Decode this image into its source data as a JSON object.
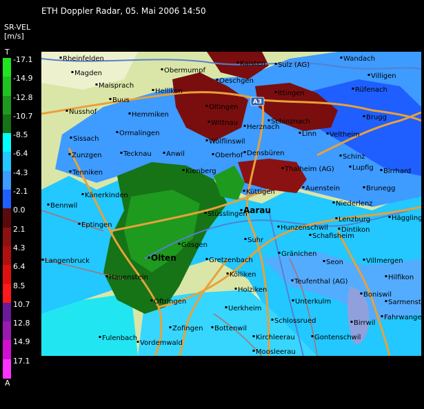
{
  "title": "ETH Doppler Radar, 05. Mai 2006 14:50",
  "legend": {
    "variable": "SR-VEL",
    "unit": "[m/s]",
    "top_marker": "T",
    "bottom_marker": "A",
    "entries": [
      {
        "label": "-17.1",
        "color": "#1fe61f"
      },
      {
        "label": "-14.9",
        "color": "#20c420"
      },
      {
        "label": "-12.8",
        "color": "#1e9a1e"
      },
      {
        "label": "-10.7",
        "color": "#167316"
      },
      {
        "label": "-8.5",
        "color": "#00ffff"
      },
      {
        "label": "-6.4",
        "color": "#22c8ff"
      },
      {
        "label": "-4.3",
        "color": "#3e9bff"
      },
      {
        "label": "-2.1",
        "color": "#1f5fff"
      },
      {
        "label": "0.0",
        "color": "#5a0a0a"
      },
      {
        "label": "2.1",
        "color": "#8b1212"
      },
      {
        "label": "4.3",
        "color": "#b01010"
      },
      {
        "label": "6.4",
        "color": "#e01010"
      },
      {
        "label": "8.5",
        "color": "#ff1a1a"
      },
      {
        "label": "10.7",
        "color": "#6a1a9a"
      },
      {
        "label": "12.8",
        "color": "#9a1ab0"
      },
      {
        "label": "14.9",
        "color": "#d010d0"
      },
      {
        "label": "17.1",
        "color": "#ff33ff"
      }
    ]
  },
  "map": {
    "places": [
      {
        "name": "Rheinfelden"
      },
      {
        "name": "Magden"
      },
      {
        "name": "Obermumpf"
      },
      {
        "name": "Kaisten"
      },
      {
        "name": "Sulz (AG)"
      },
      {
        "name": "Wandach"
      },
      {
        "name": "Maisprach"
      },
      {
        "name": "Buus"
      },
      {
        "name": "Hellikon"
      },
      {
        "name": "Oeschgen"
      },
      {
        "name": "Villigen"
      },
      {
        "name": "Ittingen"
      },
      {
        "name": "Rüfenach"
      },
      {
        "name": "Nusshof"
      },
      {
        "name": "Hemmiken"
      },
      {
        "name": "Oltingen"
      },
      {
        "name": "Wittnau"
      },
      {
        "name": "Herznach"
      },
      {
        "name": "Schinznach"
      },
      {
        "name": "Brugg"
      },
      {
        "name": "Sissach"
      },
      {
        "name": "Ormalingen"
      },
      {
        "name": "Linn"
      },
      {
        "name": "Veltheim"
      },
      {
        "name": "Zunzgen"
      },
      {
        "name": "Tecknau"
      },
      {
        "name": "Anwil"
      },
      {
        "name": "Wölflinswil"
      },
      {
        "name": "Densbüren"
      },
      {
        "name": "Oberhof"
      },
      {
        "name": "Schinz"
      },
      {
        "name": "Lupfig"
      },
      {
        "name": "Tenniken"
      },
      {
        "name": "Kienberg"
      },
      {
        "name": "Thalheim (AG)"
      },
      {
        "name": "Birrhard"
      },
      {
        "name": "Känerkinden"
      },
      {
        "name": "Küttigen"
      },
      {
        "name": "Auenstein"
      },
      {
        "name": "Brunegg"
      },
      {
        "name": "Bennwil"
      },
      {
        "name": "Aarau"
      },
      {
        "name": "Niederlenz"
      },
      {
        "name": "Eptingen"
      },
      {
        "name": "Stüsslingen"
      },
      {
        "name": "Hunzenschwil"
      },
      {
        "name": "Lenzburg"
      },
      {
        "name": "Hägglingen"
      },
      {
        "name": "Schafisheim"
      },
      {
        "name": "Dintikon"
      },
      {
        "name": "Langenbruck"
      },
      {
        "name": "Hauenstein"
      },
      {
        "name": "Gösgen"
      },
      {
        "name": "Suhr"
      },
      {
        "name": "Gränichen"
      },
      {
        "name": "Olten"
      },
      {
        "name": "Gretzenbach"
      },
      {
        "name": "Seon"
      },
      {
        "name": "Villmergen"
      },
      {
        "name": "Kölliken"
      },
      {
        "name": "Holziken"
      },
      {
        "name": "Teufenthal (AG)"
      },
      {
        "name": "Boniswil"
      },
      {
        "name": "Hilfikon"
      },
      {
        "name": "Oftringen"
      },
      {
        "name": "Uerkheim"
      },
      {
        "name": "Unterkulm"
      },
      {
        "name": "Sarmenstorf"
      },
      {
        "name": "Schlossrued"
      },
      {
        "name": "Birrwil"
      },
      {
        "name": "Fahrwangen"
      },
      {
        "name": "Zofingen"
      },
      {
        "name": "Bottenwil"
      },
      {
        "name": "Kirchleerau"
      },
      {
        "name": "Gontenschwil"
      },
      {
        "name": "Fulenbach"
      },
      {
        "name": "Vordemwald"
      },
      {
        "name": "Moosleerau"
      }
    ],
    "highway_sign": "A3"
  }
}
